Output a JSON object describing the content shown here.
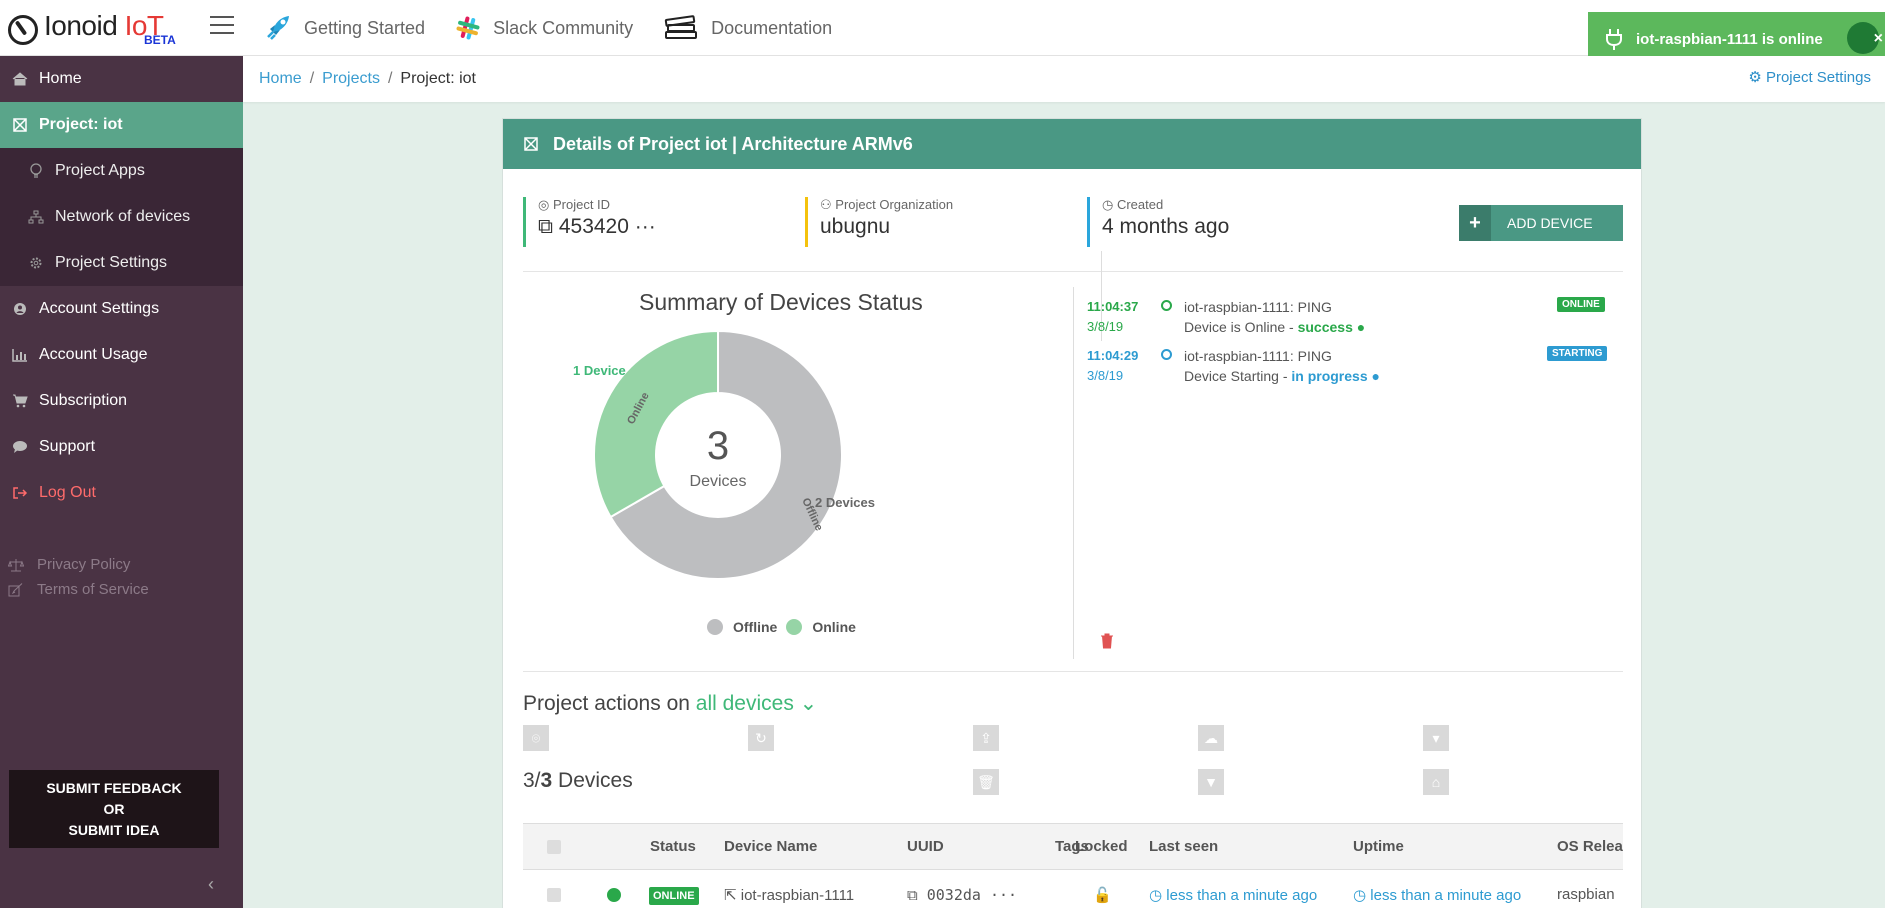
{
  "brand": {
    "name_main": "Ionoid",
    "name_iot": "IoT",
    "beta": "BETA"
  },
  "topnav": [
    {
      "label": "Getting Started",
      "icon": "rocket-icon"
    },
    {
      "label": "Slack Community",
      "icon": "slack-icon"
    },
    {
      "label": "Documentation",
      "icon": "books-icon"
    }
  ],
  "toast": {
    "message": "iot-raspbian-1111 is online",
    "close": "×"
  },
  "sidebar": {
    "items": [
      {
        "label": "Home"
      },
      {
        "label": "Project: iot"
      },
      {
        "label": "Project Apps"
      },
      {
        "label": "Network of devices"
      },
      {
        "label": "Project Settings"
      },
      {
        "label": "Account Settings"
      },
      {
        "label": "Account Usage"
      },
      {
        "label": "Subscription"
      },
      {
        "label": "Support"
      },
      {
        "label": "Log Out"
      }
    ],
    "footer": [
      {
        "label": "Privacy Policy"
      },
      {
        "label": "Terms of Service"
      }
    ],
    "feedback": {
      "line1": "SUBMIT FEEDBACK",
      "line2": "OR",
      "line3": "SUBMIT IDEA"
    },
    "collapse": "‹"
  },
  "breadcrumb": {
    "home": "Home",
    "projects": "Projects",
    "current": "Project: iot",
    "sep": "/",
    "settings": "Project Settings"
  },
  "panel": {
    "title": "Details of Project iot | Architecture ARMv6",
    "stats": {
      "project_id_label": "Project ID",
      "project_id": "453420 ···",
      "org_label": "Project Organization",
      "org": "ubugnu",
      "created_label": "Created",
      "created": "4 months ago"
    },
    "add_device": "ADD DEVICE",
    "summary_title": "Summary of Devices Status",
    "center_value": "3",
    "center_label": "Devices",
    "slice_online_text": "Online",
    "slice_offline_text": "Offline",
    "label_online": "1 Device",
    "label_offline": "2 Devices",
    "legend": {
      "offline": "Offline",
      "online": "Online"
    }
  },
  "chart_data": {
    "type": "pie",
    "title": "Summary of Devices Status",
    "categories": [
      "Offline",
      "Online"
    ],
    "values": [
      2,
      1
    ],
    "colors": [
      "#bdbec0",
      "#96d4a6"
    ],
    "total": 3,
    "legend": "bottom"
  },
  "timeline": [
    {
      "time": "11:04:37",
      "date": "3/8/19",
      "title": "iot-raspbian-1111: PING",
      "desc": "Device is Online - ",
      "status": "success",
      "badge": "ONLINE",
      "color": "#2aa84a"
    },
    {
      "time": "11:04:29",
      "date": "3/8/19",
      "title": "iot-raspbian-1111: PING",
      "desc": "Device Starting - ",
      "status": "in progress",
      "badge": "STARTING",
      "color": "#2d9bd1"
    }
  ],
  "actions": {
    "title_prefix": "Project actions on ",
    "scope": "all devices",
    "buttons": [
      {
        "label": "PING",
        "color": "#4cbf74"
      },
      {
        "label": "REBOOT",
        "color": "#f47474"
      },
      {
        "label": "DEPLOY SETTINGS",
        "color": "#f07d1c"
      },
      {
        "label": "DEPLOY APP",
        "color": "#2aa6dc"
      },
      {
        "label": "ADVANCED",
        "color": "#2aa6dc"
      },
      {
        "label": "CLEAR SEARCH",
        "color": "#cfcfcf"
      },
      {
        "label": "SEARCH DEVICES",
        "color": "#f4c20d"
      },
      {
        "label": "TAG DEVICES",
        "color": "#6cc7e6"
      }
    ]
  },
  "devices": {
    "count_prefix": "3/",
    "count_bold": "3",
    "count_suffix": " Devices",
    "columns": [
      "Status",
      "Device Name",
      "UUID",
      "Tags",
      "Locked",
      "Last seen",
      "Uptime",
      "OS Relea"
    ],
    "rows": [
      {
        "status": "ONLINE",
        "name": "iot-raspbian-1111",
        "uuid": "0032da ···",
        "last_seen": "less than a minute ago",
        "uptime": "less than a minute ago",
        "os": "raspbian"
      }
    ]
  }
}
